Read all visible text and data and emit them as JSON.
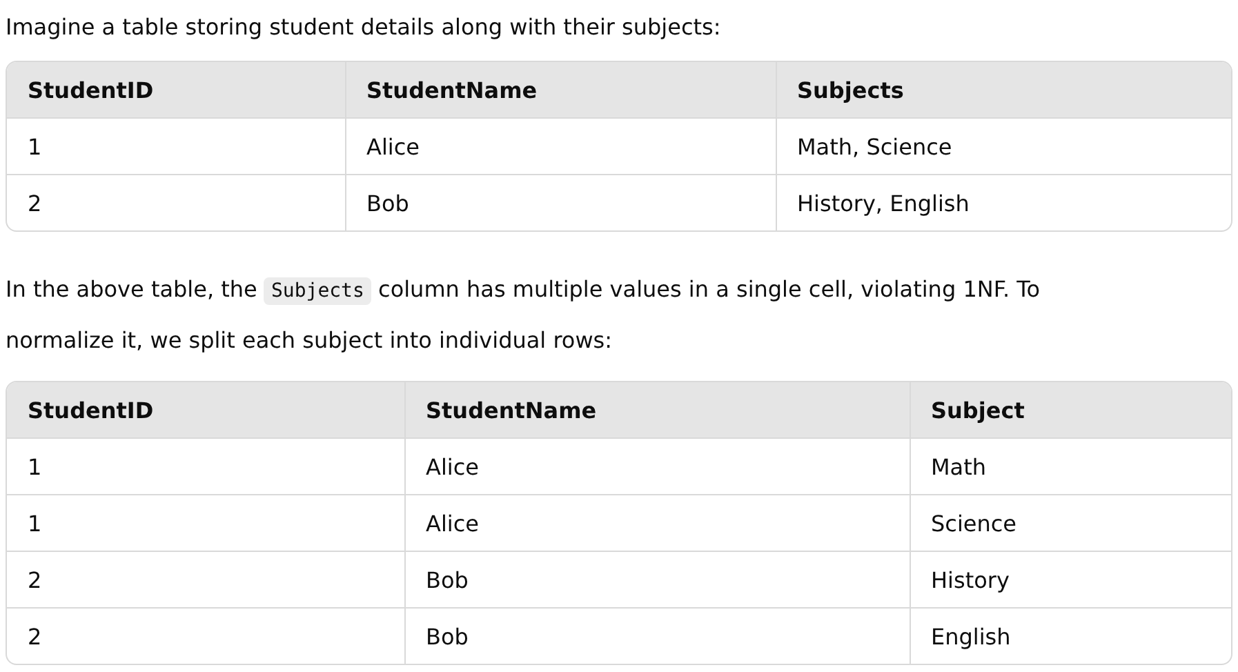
{
  "intro": "Imagine a table storing student details along with their subjects:",
  "table_1": {
    "columns": [
      "StudentID",
      "StudentName",
      "Subjects"
    ],
    "rows": [
      [
        "1",
        "Alice",
        "Math, Science"
      ],
      [
        "2",
        "Bob",
        "History, English"
      ]
    ]
  },
  "paragraph": {
    "before": "In the above table, the",
    "code": "Subjects",
    "after": "column has multiple values in a single cell, violating 1NF. To",
    "continuation": "normalize it, we split each subject into individual rows:"
  },
  "table_2": {
    "columns": [
      "StudentID",
      "StudentName",
      "Subject"
    ],
    "rows": [
      [
        "1",
        "Alice",
        "Math"
      ],
      [
        "1",
        "Alice",
        "Science"
      ],
      [
        "2",
        "Bob",
        "History"
      ],
      [
        "2",
        "Bob",
        "English"
      ]
    ]
  }
}
